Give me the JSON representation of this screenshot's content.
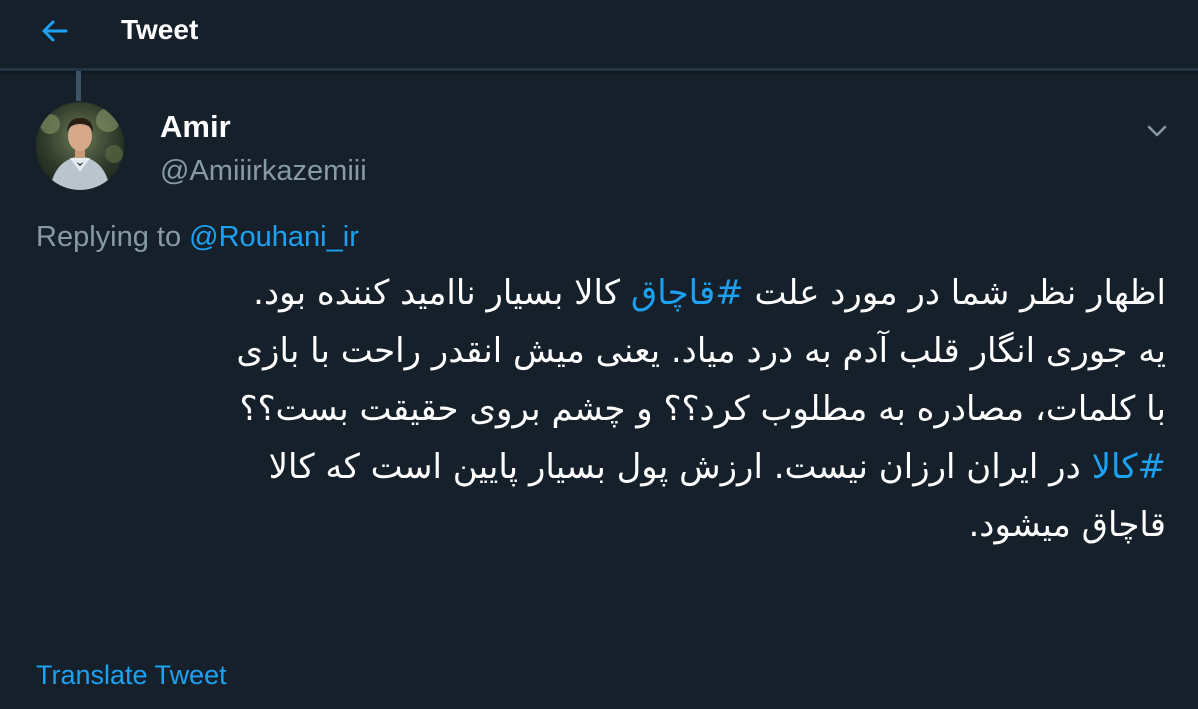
{
  "header": {
    "title": "Tweet",
    "back_icon": "arrow-left-icon"
  },
  "colors": {
    "background": "#15202b",
    "accent": "#1da1f2",
    "secondary_text": "#8899a6",
    "primary_text": "#ffffff"
  },
  "tweet": {
    "author": {
      "display_name": "Amir",
      "handle": "@Amiiirkazemiii",
      "avatar_icon": "user-avatar"
    },
    "caret_icon": "chevron-down-icon",
    "reply": {
      "prefix": "Replying to ",
      "handle": "@Rouhani_ir"
    },
    "body": {
      "line1_a": "اظهار نظر شما در مورد علت ",
      "line1_hashtag": "#قاچاق",
      "line1_b": " کالا بسیار ناامید کننده بود.",
      "line2": "یه جوری انگار قلب آدم به درد میاد. یعنی میش انقدر راحت با بازی",
      "line3": "با کلمات، مصادره به مطلوب کرد؟؟ و چشم بروی حقیقت بست؟؟",
      "line4_hashtag": "#کالا",
      "line4_b": " در ایران ارزان نیست. ارزش پول بسیار پایین است که کالا",
      "line5": "قاچاق میشود."
    },
    "translate_label": "Translate Tweet"
  }
}
